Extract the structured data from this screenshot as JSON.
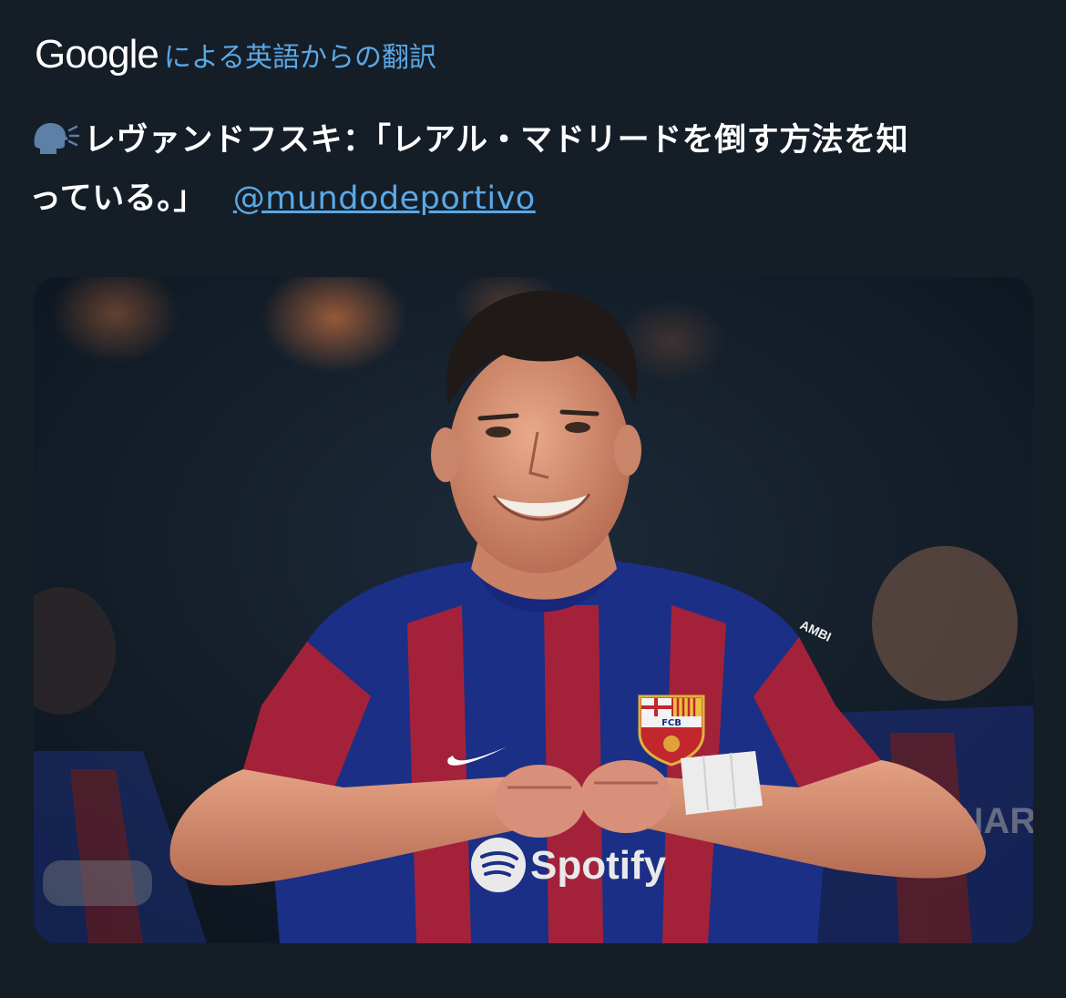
{
  "translation": {
    "provider_logo_text": "Google",
    "label": "による英語からの翻訳"
  },
  "tweet": {
    "text_line_1": "レヴァンドフスキ：「レアル・マドリードを倒す方法を知",
    "text_line_2": "っている。」",
    "mention": "@mundodeportivo",
    "leading_icon": "speaking-head-icon"
  },
  "media": {
    "jersey_sponsor_text": "Spotify",
    "crest_text": "FCB",
    "sleeve_text": "AMBI",
    "background_player_text": "A. ANAR"
  },
  "colors": {
    "background": "#151d27",
    "link": "#5aa9e6",
    "text": "#ffffff",
    "jersey_blue": "#1b2f86",
    "jersey_red": "#a3223a"
  }
}
